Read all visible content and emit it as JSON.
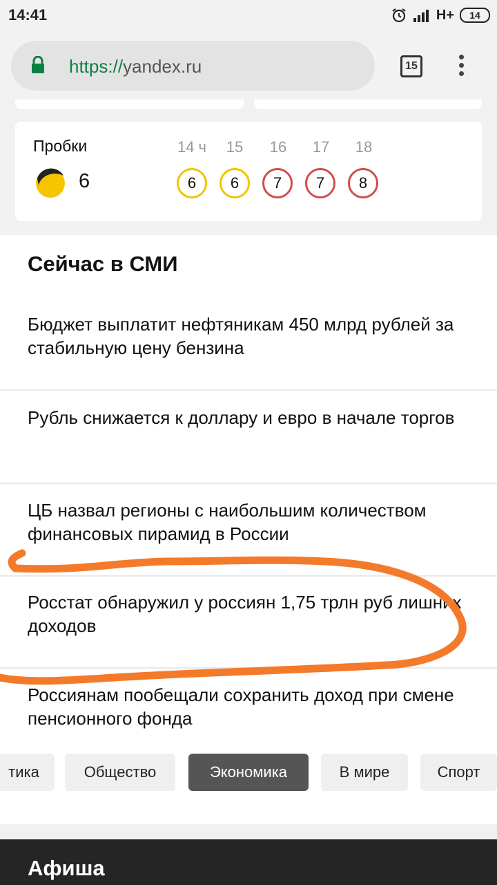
{
  "status_bar": {
    "time": "14:41",
    "network": "H+",
    "battery": "14"
  },
  "browser": {
    "url_scheme": "https://",
    "url_host": "yandex.ru",
    "tab_count": "15"
  },
  "traffic": {
    "title": "Пробки",
    "level": "6",
    "forecast": [
      {
        "hour": "14 ч",
        "level": "6",
        "color": "#f3c400"
      },
      {
        "hour": "15",
        "level": "6",
        "color": "#f3c400"
      },
      {
        "hour": "16",
        "level": "7",
        "color": "#cf4e4e"
      },
      {
        "hour": "17",
        "level": "7",
        "color": "#cf4e4e"
      },
      {
        "hour": "18",
        "level": "8",
        "color": "#cf4e4e"
      }
    ]
  },
  "news": {
    "heading": "Сейчас в СМИ",
    "items": [
      {
        "text": "Бюджет выплатит нефтяникам 450 млрд рублей за стабильную цену бензина"
      },
      {
        "text": "Рубль снижается к доллару и евро в начале торгов"
      },
      {
        "text": "ЦБ назвал регионы с наибольшим количеством финансовых пирамид в России"
      },
      {
        "text": "Росстат обнаружил у россиян 1,75 трлн руб лишних доходов"
      },
      {
        "text": "Россиянам пообещали сохранить доход при смене пенсионного фонда"
      }
    ],
    "categories": [
      {
        "label": "тика"
      },
      {
        "label": "Общество"
      },
      {
        "label": "Экономика",
        "active": true
      },
      {
        "label": "В мире"
      },
      {
        "label": "Спорт"
      }
    ]
  },
  "afisha": {
    "title": "Афиша"
  },
  "colors": {
    "traffic_yellow": "#f3c400",
    "traffic_red": "#cf4e4e",
    "annotation_orange": "#f47a2b",
    "lock_green": "#0b8043"
  }
}
